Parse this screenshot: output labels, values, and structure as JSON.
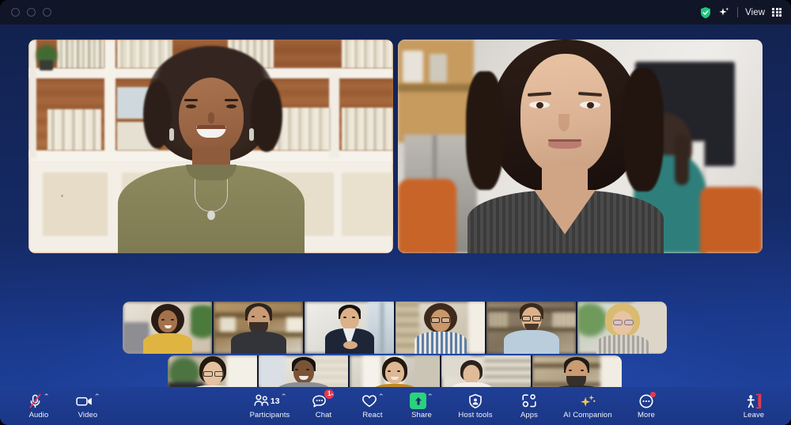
{
  "window": {
    "traffic_lights": [
      "close",
      "minimize",
      "maximize"
    ]
  },
  "titlebar": {
    "encryption_icon": "shield-check-icon",
    "ai_icon": "sparkle-icon",
    "view_label": "View",
    "view_layout_icon": "grid-icon"
  },
  "stage": {
    "background_colors": {
      "top": "#12224f",
      "bottom": "#1e4099"
    },
    "main_tiles": [
      {
        "name": "main-video-tile-1",
        "participant": "woman-curly-hair-olive-shirt",
        "scene": "white bookshelf with books and brick wall"
      },
      {
        "name": "main-video-tile-2",
        "participant": "woman-dark-bob-grey-sweater",
        "scene": "office with monitor and colleague in background"
      }
    ],
    "filmstrip_rows": [
      {
        "name": "filmstrip-row-1",
        "thumbnails": [
          "woman-yellow-sweater-plant",
          "man-beard-dark-tshirt-kitchen",
          "man-navy-blazer-window",
          "woman-glasses-curly-striped-shirt",
          "man-glasses-light-blue-shirt-shelves",
          "woman-blonde-glasses-grey-jacket"
        ]
      },
      {
        "name": "filmstrip-row-2",
        "thumbnails": [
          "woman-glasses-white-polka-top",
          "man-grey-shirt-brick-wall",
          "woman-mustard-top-window",
          "woman-laptop-red-wall",
          "man-beard-black-tshirt-loft"
        ]
      }
    ]
  },
  "toolbar": {
    "items": [
      {
        "name": "audio",
        "label": "Audio",
        "icon": "microphone-muted-icon",
        "has_caret": true,
        "badge": null,
        "count": null
      },
      {
        "name": "video",
        "label": "Video",
        "icon": "camera-icon",
        "has_caret": true,
        "badge": null,
        "count": null
      },
      {
        "name": "participants",
        "label": "Participants",
        "icon": "people-icon",
        "has_caret": true,
        "badge": null,
        "count": "13"
      },
      {
        "name": "chat",
        "label": "Chat",
        "icon": "chat-bubble-icon",
        "has_caret": true,
        "badge": "1",
        "count": null
      },
      {
        "name": "react",
        "label": "React",
        "icon": "heart-icon",
        "has_caret": true,
        "badge": null,
        "count": null
      },
      {
        "name": "share",
        "label": "Share",
        "icon": "share-screen-icon",
        "has_caret": true,
        "badge": null,
        "count": null
      },
      {
        "name": "host-tools",
        "label": "Host tools",
        "icon": "shield-icon",
        "has_caret": false,
        "badge": null,
        "count": null
      },
      {
        "name": "apps",
        "label": "Apps",
        "icon": "apps-icon",
        "has_caret": false,
        "badge": null,
        "count": null
      },
      {
        "name": "ai-companion",
        "label": "AI Companion",
        "icon": "sparkles-icon",
        "has_caret": false,
        "badge": null,
        "count": null
      },
      {
        "name": "more",
        "label": "More",
        "icon": "more-circle-icon",
        "has_caret": false,
        "badge": "dot",
        "count": null
      }
    ],
    "leave": {
      "label": "Leave",
      "icon": "leave-door-icon",
      "color": "#e8384f"
    },
    "colors": {
      "background": "#1f3f96",
      "share_green": "#2bd17e",
      "badge_red": "#e8384f",
      "ai_yellow": "#f2c94c",
      "label": "#f1f4fb"
    }
  }
}
